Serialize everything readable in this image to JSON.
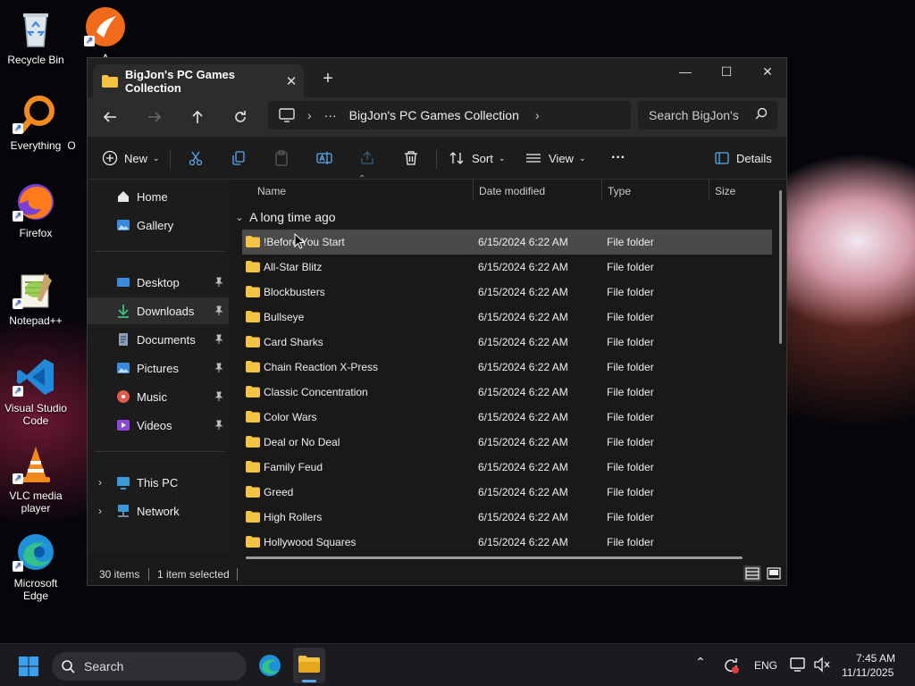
{
  "desktop": {
    "icons": [
      {
        "label": "Recycle Bin"
      },
      {
        "label": "A"
      },
      {
        "label": "Everything"
      },
      {
        "label": "O"
      },
      {
        "label": "Firefox"
      },
      {
        "label": "Notepad++"
      },
      {
        "label": "Visual Studio Code"
      },
      {
        "label": "VLC media player"
      },
      {
        "label": "Microsoft Edge"
      }
    ]
  },
  "window": {
    "tab_title": "BigJon's PC Games Collection",
    "tab_close": "✕",
    "new_tab": "+",
    "controls": {
      "minimize": "—",
      "maximize": "☐",
      "close": "✕"
    }
  },
  "navbar": {
    "address_more": "···",
    "address_folder": "BigJon's PC Games Collection",
    "search_placeholder": "Search BigJon's"
  },
  "commandbar": {
    "new_label": "New",
    "sort_label": "Sort",
    "view_label": "View",
    "more_label": "···",
    "details_label": "Details"
  },
  "navpane": {
    "items": [
      {
        "label": "Home"
      },
      {
        "label": "Gallery"
      },
      {
        "label": "Desktop"
      },
      {
        "label": "Downloads"
      },
      {
        "label": "Documents"
      },
      {
        "label": "Pictures"
      },
      {
        "label": "Music"
      },
      {
        "label": "Videos"
      },
      {
        "label": "This PC"
      },
      {
        "label": "Network"
      }
    ]
  },
  "content": {
    "columns": {
      "name": "Name",
      "date": "Date modified",
      "type": "Type",
      "size": "Size"
    },
    "group_header": "A long time ago",
    "rows": [
      {
        "name": "!Before You Start",
        "date": "6/15/2024 6:22 AM",
        "type": "File folder"
      },
      {
        "name": "All-Star Blitz",
        "date": "6/15/2024 6:22 AM",
        "type": "File folder"
      },
      {
        "name": "Blockbusters",
        "date": "6/15/2024 6:22 AM",
        "type": "File folder"
      },
      {
        "name": "Bullseye",
        "date": "6/15/2024 6:22 AM",
        "type": "File folder"
      },
      {
        "name": "Card Sharks",
        "date": "6/15/2024 6:22 AM",
        "type": "File folder"
      },
      {
        "name": "Chain Reaction X-Press",
        "date": "6/15/2024 6:22 AM",
        "type": "File folder"
      },
      {
        "name": "Classic Concentration",
        "date": "6/15/2024 6:22 AM",
        "type": "File folder"
      },
      {
        "name": "Color Wars",
        "date": "6/15/2024 6:22 AM",
        "type": "File folder"
      },
      {
        "name": "Deal or No Deal",
        "date": "6/15/2024 6:22 AM",
        "type": "File folder"
      },
      {
        "name": "Family Feud",
        "date": "6/15/2024 6:22 AM",
        "type": "File folder"
      },
      {
        "name": "Greed",
        "date": "6/15/2024 6:22 AM",
        "type": "File folder"
      },
      {
        "name": "High Rollers",
        "date": "6/15/2024 6:22 AM",
        "type": "File folder"
      },
      {
        "name": "Hollywood Squares",
        "date": "6/15/2024 6:22 AM",
        "type": "File folder"
      }
    ]
  },
  "statusbar": {
    "item_count": "30 items",
    "selection": "1 item selected"
  },
  "taskbar": {
    "search_label": "Search",
    "language": "ENG",
    "time": "7:45 AM",
    "date": "11/11/2025"
  },
  "colors": {
    "folder_yellow": "#f5c342",
    "selection_bg": "#4a4a4a",
    "window_bg": "#191919"
  }
}
